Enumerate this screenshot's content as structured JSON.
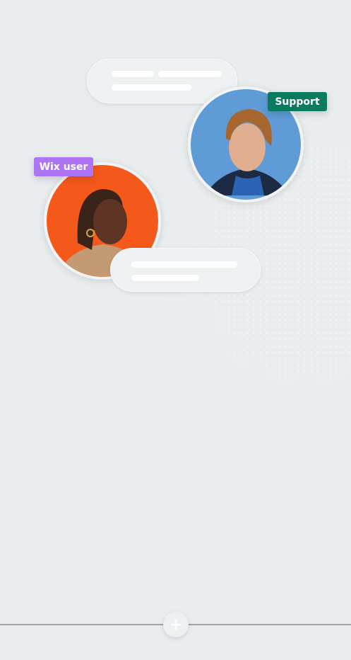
{
  "badges": {
    "support": "Support",
    "user": "Wix user"
  },
  "colors": {
    "background": "#e8ecec",
    "support_badge": "#0b7a5e",
    "user_badge": "#ad75f5",
    "support_avatar_bg": "#5f9bd6",
    "user_avatar_bg": "#f4581a"
  },
  "add_button": {
    "icon": "plus-icon",
    "label": "+"
  }
}
